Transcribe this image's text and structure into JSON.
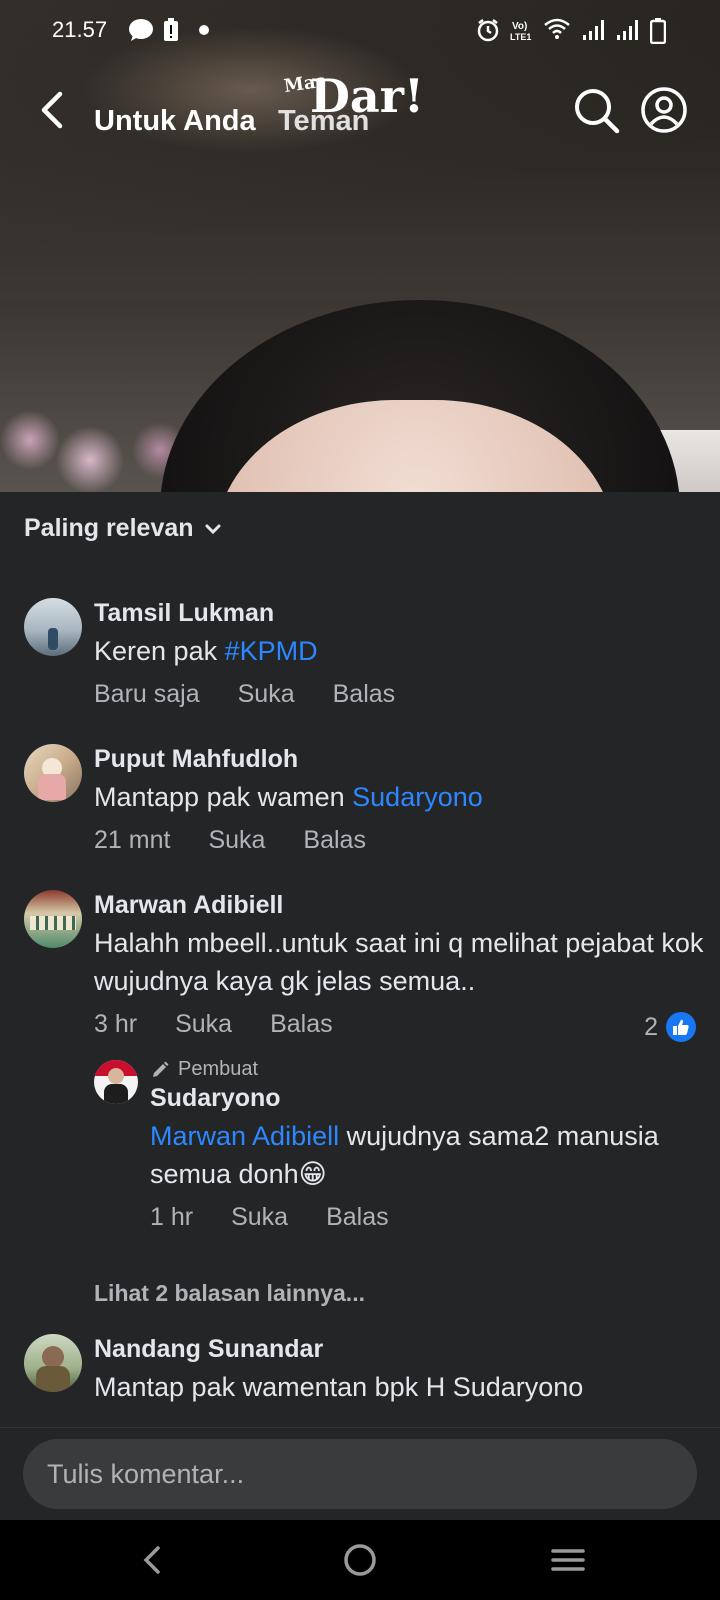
{
  "status_bar": {
    "time": "21.57",
    "icons": [
      "message-icon",
      "battery-saver-icon",
      "dot-icon",
      "alarm-icon",
      "volte-icon",
      "wifi-icon",
      "signal-icon",
      "signal-icon-2",
      "battery-icon"
    ]
  },
  "header": {
    "tabs": [
      {
        "label": "Untuk Anda",
        "active": true
      },
      {
        "label": "Teman",
        "active": false
      }
    ],
    "watermark_small": "Mas",
    "watermark_big": "Dar!"
  },
  "comments": {
    "sort_label": "Paling relevan",
    "items": [
      {
        "name": "Tamsil Lukman",
        "text": "Keren pak ",
        "link": "#KPMD",
        "time": "Baru saja",
        "like": "Suka",
        "reply": "Balas"
      },
      {
        "name": "Puput Mahfudloh",
        "text": "Mantapp pak wamen ",
        "link": "Sudaryono",
        "time": "21 mnt",
        "like": "Suka",
        "reply": "Balas"
      },
      {
        "name": "Marwan Adibiell",
        "text": "Halahh mbeell..untuk saat ini q melihat pejabat kok wujudnya kaya gk jelas semua..",
        "time": "3 hr",
        "like": "Suka",
        "reply": "Balas",
        "reaction_count": "2"
      }
    ],
    "reply": {
      "author_tag": "Pembuat",
      "name": "Sudaryono",
      "link": "Marwan Adibiell",
      "text": " wujudnya sama2 manusia semua donh",
      "emoji": "😁",
      "time": "1 hr",
      "like": "Suka",
      "reply": "Balas"
    },
    "see_more": "Lihat 2 balasan lainnya...",
    "last": {
      "name": "Nandang Sunandar",
      "text": "Mantap pak wamentan bpk H Sudaryono"
    }
  },
  "input": {
    "placeholder": "Tulis komentar..."
  },
  "nav": {
    "buttons": [
      "back-nav-icon",
      "home-nav-icon",
      "recents-nav-icon"
    ]
  }
}
